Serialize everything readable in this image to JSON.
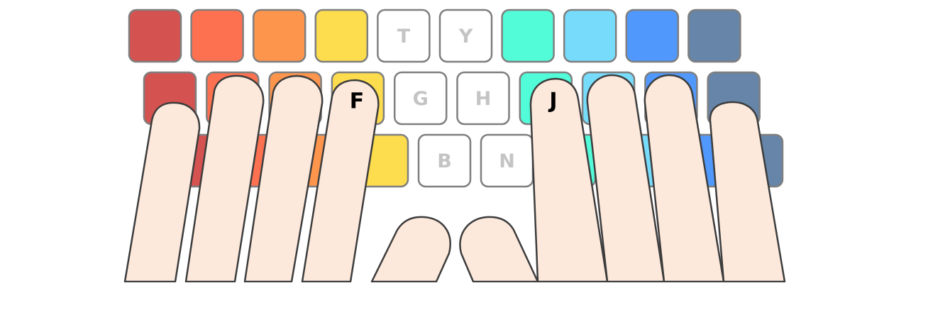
{
  "colors": {
    "left_pinky": "#d45250",
    "left_ring": "#fe7150",
    "left_middle": "#fe954d",
    "left_index": "#fddc4d",
    "unassigned": "#ffffff",
    "right_index": "#52fcd8",
    "right_middle": "#77dcfc",
    "right_ring": "#5198fc",
    "right_pinky": "#6785a8",
    "finger_fill": "#fde9dc",
    "finger_stroke": "#3d3d3d"
  },
  "rows": {
    "top": [
      {
        "label": "",
        "color": "left_pinky"
      },
      {
        "label": "",
        "color": "left_ring"
      },
      {
        "label": "",
        "color": "left_middle"
      },
      {
        "label": "",
        "color": "left_index"
      },
      {
        "label": "T",
        "color": "unassigned"
      },
      {
        "label": "Y",
        "color": "unassigned"
      },
      {
        "label": "",
        "color": "right_index"
      },
      {
        "label": "",
        "color": "right_middle"
      },
      {
        "label": "",
        "color": "right_ring"
      },
      {
        "label": "",
        "color": "right_pinky"
      }
    ],
    "home": [
      {
        "label": "",
        "color": "left_pinky"
      },
      {
        "label": "",
        "color": "left_ring"
      },
      {
        "label": "",
        "color": "left_middle"
      },
      {
        "label": "",
        "color": "left_index"
      },
      {
        "label": "G",
        "color": "unassigned"
      },
      {
        "label": "H",
        "color": "unassigned"
      },
      {
        "label": "",
        "color": "right_index"
      },
      {
        "label": "",
        "color": "right_middle"
      },
      {
        "label": "",
        "color": "right_ring"
      },
      {
        "label": "",
        "color": "right_pinky"
      }
    ],
    "bottom": [
      {
        "label": "",
        "color": "left_pinky"
      },
      {
        "label": "",
        "color": "left_ring"
      },
      {
        "label": "",
        "color": "left_middle"
      },
      {
        "label": "",
        "color": "left_index"
      },
      {
        "label": "B",
        "color": "unassigned"
      },
      {
        "label": "N",
        "color": "unassigned"
      },
      {
        "label": "",
        "color": "right_index"
      },
      {
        "label": "",
        "color": "right_middle"
      },
      {
        "label": "",
        "color": "right_ring"
      },
      {
        "label": "",
        "color": "right_pinky"
      }
    ]
  },
  "home_labels": {
    "left": "F",
    "right": "J"
  }
}
